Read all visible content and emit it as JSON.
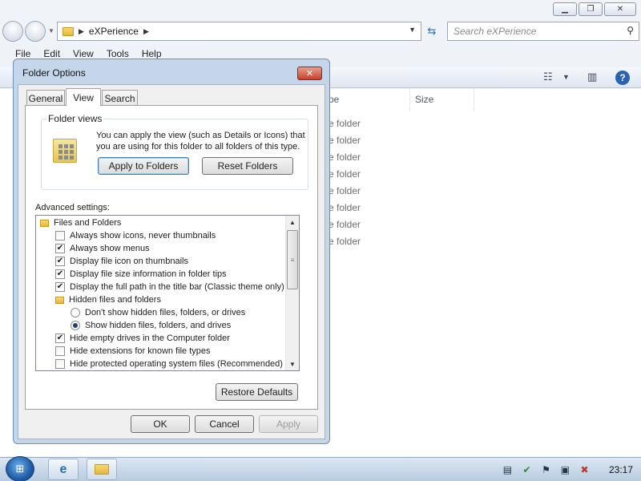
{
  "explorer": {
    "address": {
      "crumb": "eXPerience"
    },
    "search": {
      "placeholder": "Search eXPerience"
    },
    "menu": [
      "File",
      "Edit",
      "View",
      "Tools",
      "Help"
    ],
    "columns": {
      "type": "pe",
      "size": "Size"
    },
    "file_types": [
      "e folder",
      "e folder",
      "e folder",
      "e folder",
      "e folder",
      "e folder",
      "e folder",
      "e folder"
    ]
  },
  "dialog": {
    "title": "Folder Options",
    "tabs": [
      "General",
      "View",
      "Search"
    ],
    "active_tab": "View",
    "folder_views": {
      "label": "Folder views",
      "description": "You can apply the view (such as Details or Icons) that you are using for this folder to all folders of this type.",
      "apply_button": "Apply to Folders",
      "reset_button": "Reset Folders"
    },
    "advanced_label": "Advanced settings:",
    "tree": [
      {
        "type": "folder",
        "label": "Files and Folders",
        "indent": 0
      },
      {
        "type": "checkbox",
        "label": "Always show icons, never thumbnails",
        "checked": false,
        "indent": 1
      },
      {
        "type": "checkbox",
        "label": "Always show menus",
        "checked": true,
        "indent": 1
      },
      {
        "type": "checkbox",
        "label": "Display file icon on thumbnails",
        "checked": true,
        "indent": 1
      },
      {
        "type": "checkbox",
        "label": "Display file size information in folder tips",
        "checked": true,
        "indent": 1
      },
      {
        "type": "checkbox",
        "label": "Display the full path in the title bar (Classic theme only)",
        "checked": true,
        "indent": 1
      },
      {
        "type": "folder",
        "label": "Hidden files and folders",
        "indent": 1
      },
      {
        "type": "radio",
        "label": "Don't show hidden files, folders, or drives",
        "checked": false,
        "indent": 2
      },
      {
        "type": "radio",
        "label": "Show hidden files, folders, and drives",
        "checked": true,
        "indent": 2
      },
      {
        "type": "checkbox",
        "label": "Hide empty drives in the Computer folder",
        "checked": true,
        "indent": 1
      },
      {
        "type": "checkbox",
        "label": "Hide extensions for known file types",
        "checked": false,
        "indent": 1
      },
      {
        "type": "checkbox",
        "label": "Hide protected operating system files (Recommended)",
        "checked": false,
        "indent": 1
      }
    ],
    "restore_button": "Restore Defaults",
    "ok_button": "OK",
    "cancel_button": "Cancel",
    "apply_button": "Apply"
  },
  "taskbar": {
    "clock": "23:17"
  }
}
